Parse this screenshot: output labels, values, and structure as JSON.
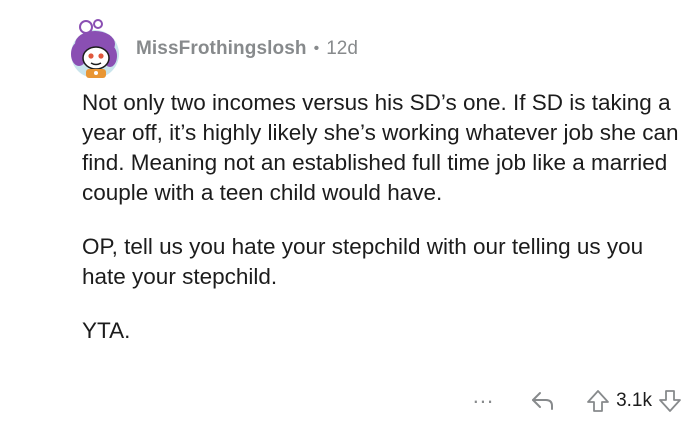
{
  "comment": {
    "author": "MissFrothingslosh",
    "separator": "•",
    "time": "12d",
    "paragraphs": [
      "Not only two incomes versus his SD’s one. If SD is taking a year off, it’s highly likely she’s working whatever job she can find. Meaning not an established full time job like a married couple with a teen child would have.",
      "OP, tell us you hate your stepchild with our telling us you hate your stepchild.",
      "YTA."
    ],
    "score": "3.1k"
  },
  "actions": {
    "more_label": "...",
    "icons": {
      "more": "more-icon",
      "reply": "reply-icon",
      "upvote": "upvote-icon",
      "downvote": "downvote-icon"
    }
  },
  "colors": {
    "text": "#1c1c1c",
    "meta": "#878a8c",
    "avatar_bg": "#c9e4ec",
    "avatar_hair": "#8a4fb3",
    "avatar_accent": "#e99634"
  }
}
